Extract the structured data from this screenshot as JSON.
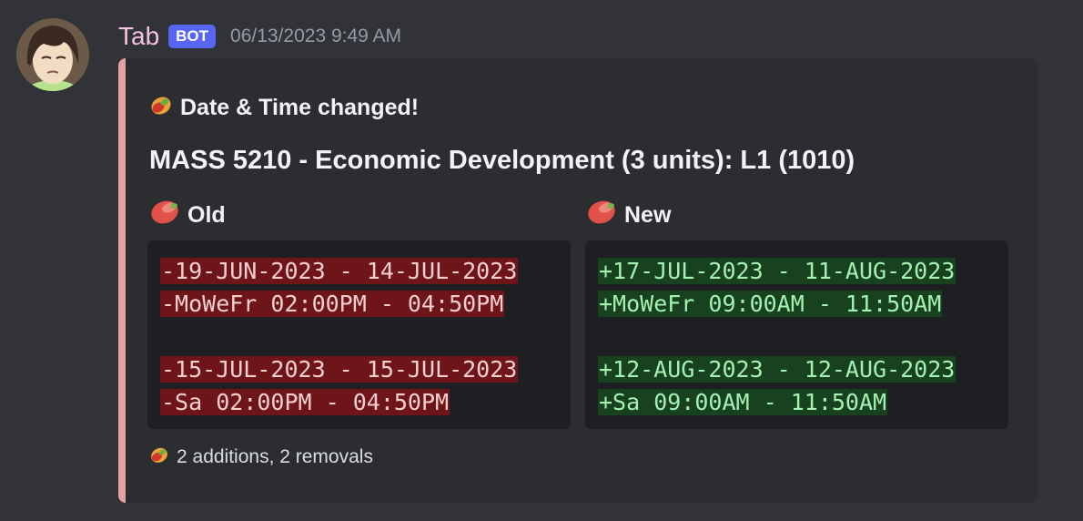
{
  "message": {
    "username": "Tab",
    "badge": "BOT",
    "timestamp": "06/13/2023 9:49 AM",
    "avatar_icon": "anime-girl-avatar"
  },
  "embed": {
    "accent_color": "#e9a1a5",
    "author": "Date & Time changed!",
    "title": "MASS 5210 - Economic Development (3 units): L1 (1010)",
    "fields": [
      {
        "name": "Old",
        "icon": "mango-red-icon",
        "lines": [
          "-19-JUN-2023 - 14-JUL-2023",
          "-MoWeFr 02:00PM - 04:50PM",
          "",
          "-15-JUL-2023 - 15-JUL-2023",
          "-Sa 02:00PM - 04:50PM"
        ]
      },
      {
        "name": "New",
        "icon": "mango-red-icon",
        "lines": [
          "+17-JUL-2023 - 11-AUG-2023",
          "+MoWeFr 09:00AM - 11:50AM",
          "",
          "+12-AUG-2023 - 12-AUG-2023",
          "+Sa 09:00AM - 11:50AM"
        ]
      }
    ],
    "footer": "2 additions, 2 removals",
    "author_icon": "mango-icon",
    "footer_icon": "mango-icon"
  }
}
